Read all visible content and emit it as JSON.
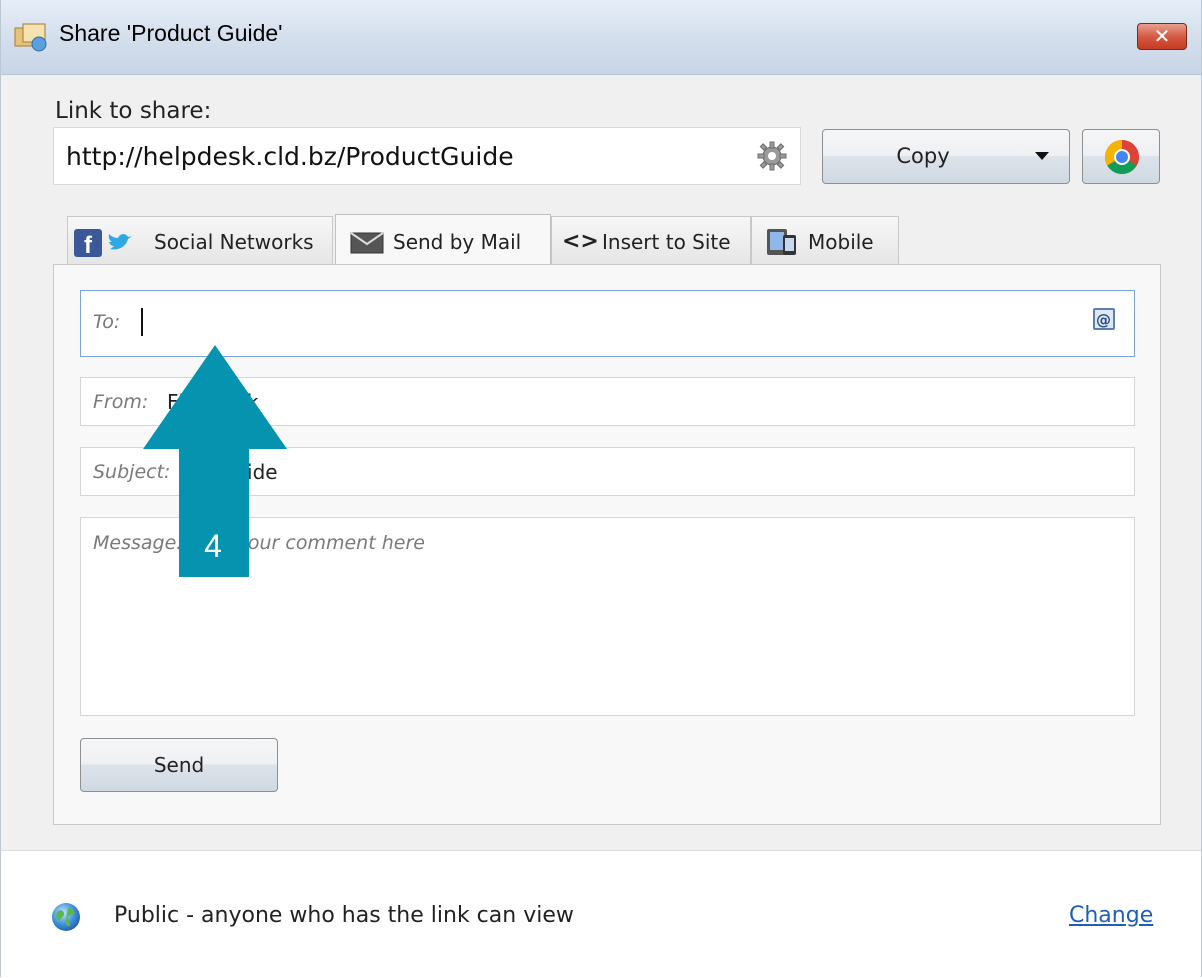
{
  "window": {
    "title": "Share 'Product Guide'",
    "close_glyph": "✕"
  },
  "link": {
    "label": "Link to share:",
    "url": "http://helpdesk.cld.bz/ProductGuide"
  },
  "buttons": {
    "copy": "Copy",
    "send": "Send"
  },
  "tabs": [
    {
      "label": "Social Networks",
      "icon": "facebook-twitter-icon",
      "active": false
    },
    {
      "label": "Send by Mail",
      "icon": "envelope-icon",
      "active": true
    },
    {
      "label": "Insert to Site",
      "icon": "code-icon",
      "active": false
    },
    {
      "label": "Mobile",
      "icon": "mobile-icon",
      "active": false
    }
  ],
  "mail": {
    "to_label": "To:",
    "to_value": "",
    "from_label": "From:",
    "from_value": "Flip   Book",
    "subject_label": "Subject:",
    "subject_value": "   uct Guide",
    "message_placeholder": "Message:      e your comment here"
  },
  "footer": {
    "privacy_text": "Public - anyone who has the link can view",
    "change_link": "Change"
  },
  "callout": {
    "number": "4"
  },
  "colors": {
    "callout": "#0693b0",
    "link": "#1f5fb8",
    "accent_focus": "#7aa7d6"
  }
}
